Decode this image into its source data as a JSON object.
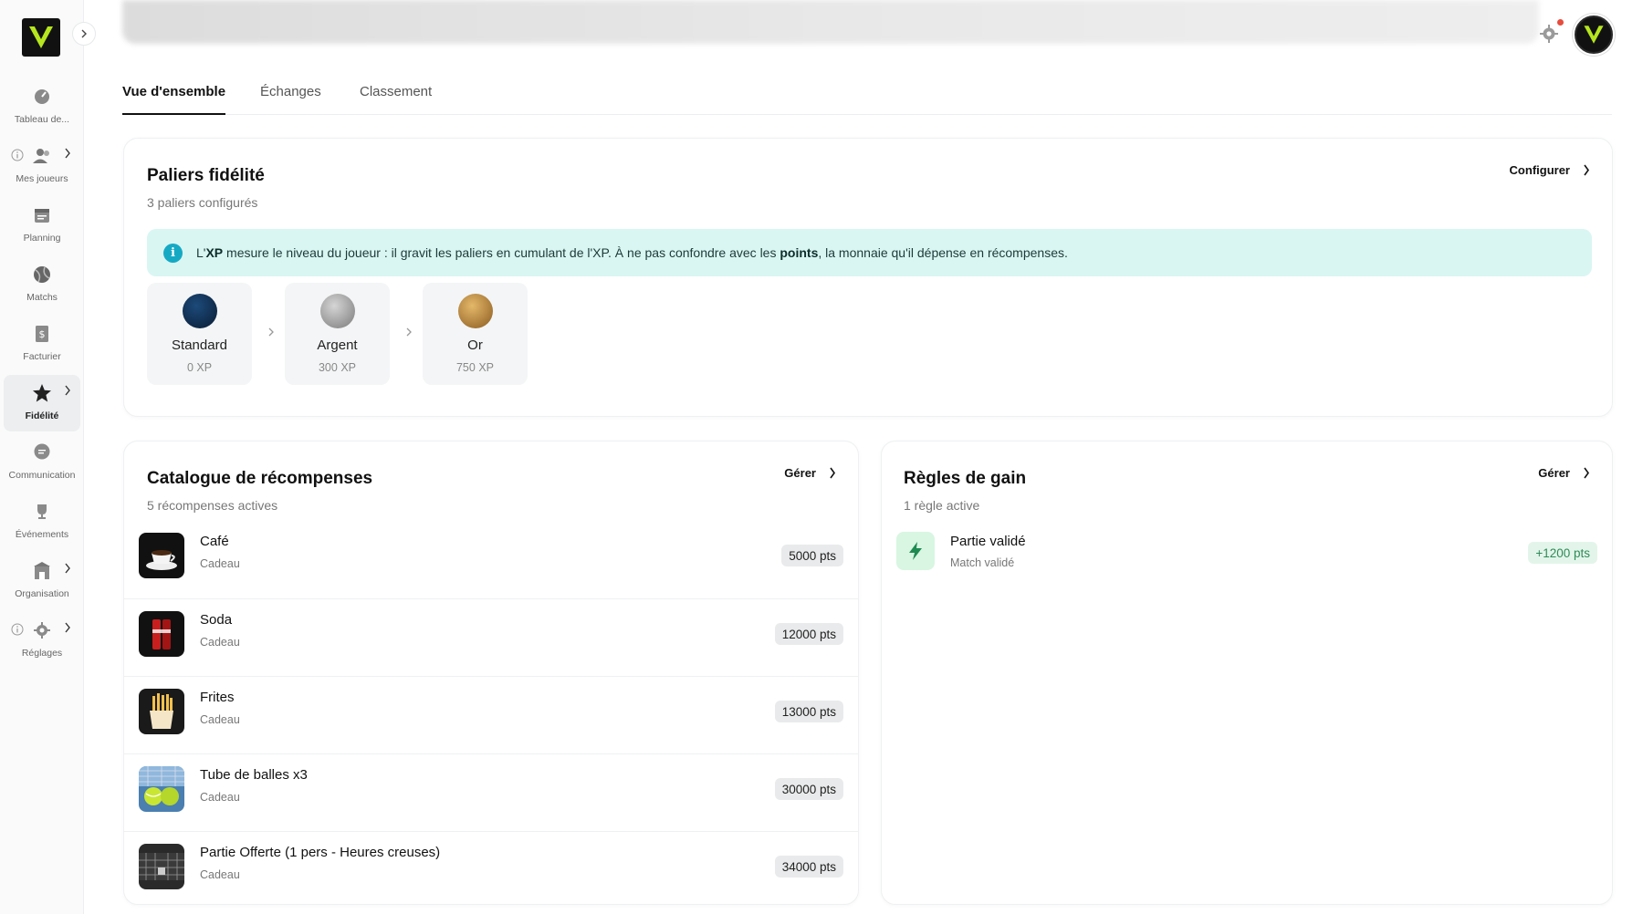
{
  "sidebar": {
    "items": [
      {
        "label": "Tableau de...",
        "icon": "dashboard-icon"
      },
      {
        "label": "Mes joueurs",
        "icon": "users-icon"
      },
      {
        "label": "Planning",
        "icon": "calendar-icon"
      },
      {
        "label": "Matchs",
        "icon": "ball-icon"
      },
      {
        "label": "Facturier",
        "icon": "invoice-icon"
      },
      {
        "label": "Fidélité",
        "icon": "star-icon"
      },
      {
        "label": "Communication",
        "icon": "chat-icon"
      },
      {
        "label": "Événements",
        "icon": "trophy-icon"
      },
      {
        "label": "Organisation",
        "icon": "building-icon"
      },
      {
        "label": "Réglages",
        "icon": "gear-icon"
      }
    ],
    "active_index": 5
  },
  "tabs": [
    {
      "label": "Vue d'ensemble",
      "active": true
    },
    {
      "label": "Échanges",
      "active": false
    },
    {
      "label": "Classement",
      "active": false
    }
  ],
  "tiers_card": {
    "title": "Paliers fidélité",
    "subtitle": "3 paliers configurés",
    "action": "Configurer",
    "banner": {
      "t1": "L'",
      "b1": "XP",
      "t2": " mesure le niveau du joueur : il gravit les paliers en cumulant de l'XP. À ne pas confondre avec les ",
      "b2": "points",
      "t3": ", la monnaie qu'il dépense en récompenses."
    },
    "tiers": [
      {
        "name": "Standard",
        "xp": "0 XP",
        "color": "#0f2a4a"
      },
      {
        "name": "Argent",
        "xp": "300 XP",
        "color": "#9a9a9a"
      },
      {
        "name": "Or",
        "xp": "750 XP",
        "color": "#b8873a"
      }
    ]
  },
  "rewards_card": {
    "title": "Catalogue de récompenses",
    "subtitle": "5 récompenses actives",
    "action": "Gérer",
    "items": [
      {
        "name": "Café",
        "category": "Cadeau",
        "points": "5000 pts"
      },
      {
        "name": "Soda",
        "category": "Cadeau",
        "points": "12000 pts"
      },
      {
        "name": "Frites",
        "category": "Cadeau",
        "points": "13000 pts"
      },
      {
        "name": "Tube de balles x3",
        "category": "Cadeau",
        "points": "30000 pts"
      },
      {
        "name": "Partie Offerte (1 pers - Heures creuses)",
        "category": "Cadeau",
        "points": "34000 pts"
      }
    ]
  },
  "rules_card": {
    "title": "Règles de gain",
    "subtitle": "1 règle active",
    "action": "Gérer",
    "rules": [
      {
        "name": "Partie validé",
        "sub": "Match validé",
        "points": "+1200 pts"
      }
    ]
  },
  "colors": {
    "accent": "#16a9c4",
    "banner_bg": "#d9f6f3",
    "logo_green": "#b6e61e",
    "success": "#2e8b57"
  }
}
